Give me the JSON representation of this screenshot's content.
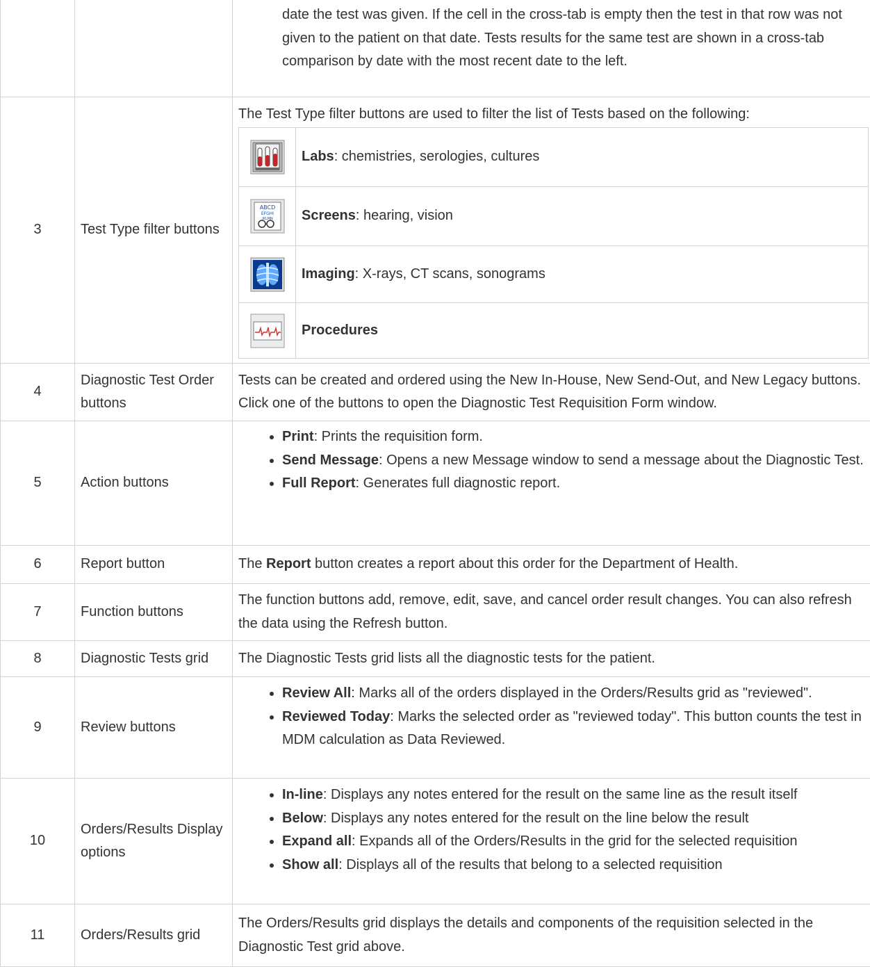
{
  "rows": [
    {
      "num": "",
      "name": "",
      "text": "date the test was given. If the cell in the cross-tab is empty then the test in that row was not given to the patient on that date. Tests results for the same test are shown in a cross-tab comparison by date with the most recent date to the left."
    },
    {
      "num": "3",
      "name": "Test Type filter buttons",
      "intro": "The Test Type filter buttons are used to filter the list of Tests based on the following:",
      "filters": [
        {
          "icon": "labs-test-tubes-icon",
          "label": "Labs",
          "desc": ": chemistries, serologies, cultures"
        },
        {
          "icon": "screens-eye-chart-icon",
          "label": "Screens",
          "desc": ": hearing, vision"
        },
        {
          "icon": "imaging-xray-icon",
          "label": "Imaging",
          "desc": ": X-rays, CT scans, sonograms"
        },
        {
          "icon": "procedures-ecg-icon",
          "label": "Procedures",
          "desc": ""
        }
      ]
    },
    {
      "num": "4",
      "name": "Diagnostic Test Order buttons",
      "text": "Tests can be created and ordered using the New In-House, New Send-Out, and New Legacy buttons. Click one of the buttons to open the Diagnostic Test Requisition Form window."
    },
    {
      "num": "5",
      "name": "Action buttons",
      "items": [
        {
          "label": "Print",
          "desc": ": Prints the requisition form."
        },
        {
          "label": "Send Message",
          "desc": ": Opens a new Message window to send a message about the Diagnostic Test."
        },
        {
          "label": "Full Report",
          "desc": ": Generates full diagnostic report."
        }
      ]
    },
    {
      "num": "6",
      "name": "Report button",
      "pre": "The ",
      "bold": "Report",
      "post": " button creates a report about this order for the Department of Health."
    },
    {
      "num": "7",
      "name": "Function buttons",
      "text": "The function buttons add, remove, edit, save, and cancel order result changes. You can also refresh the data using the Refresh button."
    },
    {
      "num": "8",
      "name": "Diagnostic Tests grid",
      "text": "The Diagnostic Tests grid lists all the diagnostic tests for the patient."
    },
    {
      "num": "9",
      "name": "Review buttons",
      "items": [
        {
          "label": "Review All",
          "desc": ": Marks all of the orders displayed in the Orders/Results grid as \"reviewed\"."
        },
        {
          "label": "Reviewed Today",
          "desc": ": Marks the selected order as \"reviewed today\". This button counts the test in MDM calculation as Data Reviewed."
        }
      ]
    },
    {
      "num": "10",
      "name": "Orders/Results Display options",
      "items": [
        {
          "label": "In-line",
          "desc": ": Displays any notes entered for the result on the same line as the result itself"
        },
        {
          "label": "Below",
          "desc": ": Displays any notes entered for the result on the line below the result"
        },
        {
          "label": "Expand all",
          "desc": ": Expands all of the Orders/Results in the grid for the selected requisition"
        },
        {
          "label": "Show all",
          "desc": ": Displays all of the results that belong to a selected requisition"
        }
      ]
    },
    {
      "num": "11",
      "name": "Orders/Results grid",
      "text": "The Orders/Results grid displays the details and components of the requisition selected in the Diagnostic Test grid above."
    }
  ]
}
